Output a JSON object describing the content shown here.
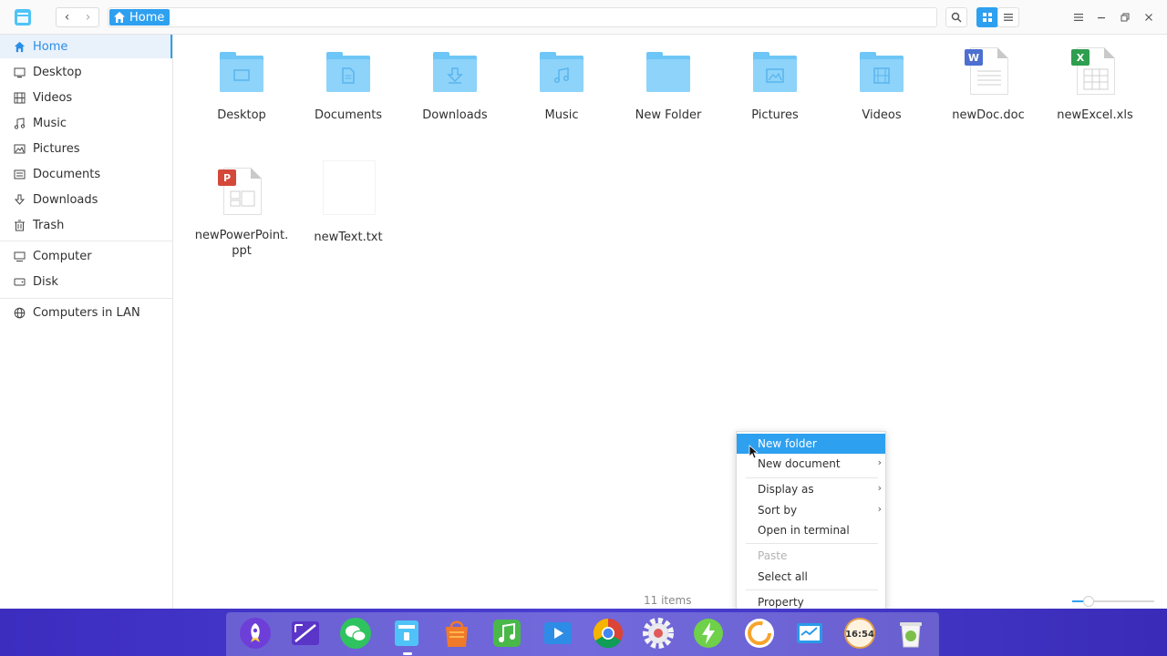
{
  "window": {
    "breadcrumb": "Home",
    "nav": {
      "back_label": "‹",
      "forward_label": "›"
    }
  },
  "sidebar": {
    "items": [
      {
        "label": "Home",
        "icon": "home-icon"
      },
      {
        "label": "Desktop",
        "icon": "desktop-icon"
      },
      {
        "label": "Videos",
        "icon": "video-icon"
      },
      {
        "label": "Music",
        "icon": "music-icon"
      },
      {
        "label": "Pictures",
        "icon": "picture-icon"
      },
      {
        "label": "Documents",
        "icon": "document-icon"
      },
      {
        "label": "Downloads",
        "icon": "download-icon"
      },
      {
        "label": "Trash",
        "icon": "trash-icon"
      },
      {
        "label": "Computer",
        "icon": "computer-icon"
      },
      {
        "label": "Disk",
        "icon": "disk-icon"
      },
      {
        "label": "Computers in LAN",
        "icon": "network-icon"
      }
    ]
  },
  "files": [
    {
      "name": "Desktop",
      "type": "folder",
      "glyph": "desktop"
    },
    {
      "name": "Documents",
      "type": "folder",
      "glyph": "document"
    },
    {
      "name": "Downloads",
      "type": "folder",
      "glyph": "download"
    },
    {
      "name": "Music",
      "type": "folder",
      "glyph": "music"
    },
    {
      "name": "New Folder",
      "type": "folder",
      "glyph": "none"
    },
    {
      "name": "Pictures",
      "type": "folder",
      "glyph": "picture"
    },
    {
      "name": "Videos",
      "type": "folder",
      "glyph": "video"
    },
    {
      "name": "newDoc.doc",
      "type": "doc",
      "badge": "W"
    },
    {
      "name": "newExcel.xls",
      "type": "xls",
      "badge": "X"
    },
    {
      "name": "newPowerPoint.\nppt",
      "type": "ppt",
      "badge": "P"
    },
    {
      "name": "newText.txt",
      "type": "txt"
    }
  ],
  "status": {
    "item_count": "11 items",
    "zoom_level": 0.2
  },
  "context_menu": {
    "items": [
      {
        "label": "New folder",
        "state": "highlighted"
      },
      {
        "label": "New document",
        "submenu": true
      },
      {
        "label": "Display as",
        "submenu": true
      },
      {
        "label": "Sort by",
        "submenu": true
      },
      {
        "label": "Open in terminal"
      },
      {
        "label": "Paste",
        "state": "disabled"
      },
      {
        "label": "Select all"
      },
      {
        "label": "Property"
      }
    ],
    "submenu_arrow": "›"
  },
  "dock": {
    "apps": [
      "launcher-icon",
      "screenshot-icon",
      "wechat-icon",
      "file-manager-icon",
      "app-store-icon",
      "music-player-icon",
      "video-player-icon",
      "chrome-icon",
      "settings-icon",
      "power-icon",
      "refresh-icon",
      "system-monitor-icon",
      "clock-icon",
      "trash-icon"
    ],
    "clock_text": "16:54"
  },
  "colors": {
    "accent": "#2ea0f0",
    "folder": "#8dd3fa",
    "dock": "#4a3fd2"
  }
}
